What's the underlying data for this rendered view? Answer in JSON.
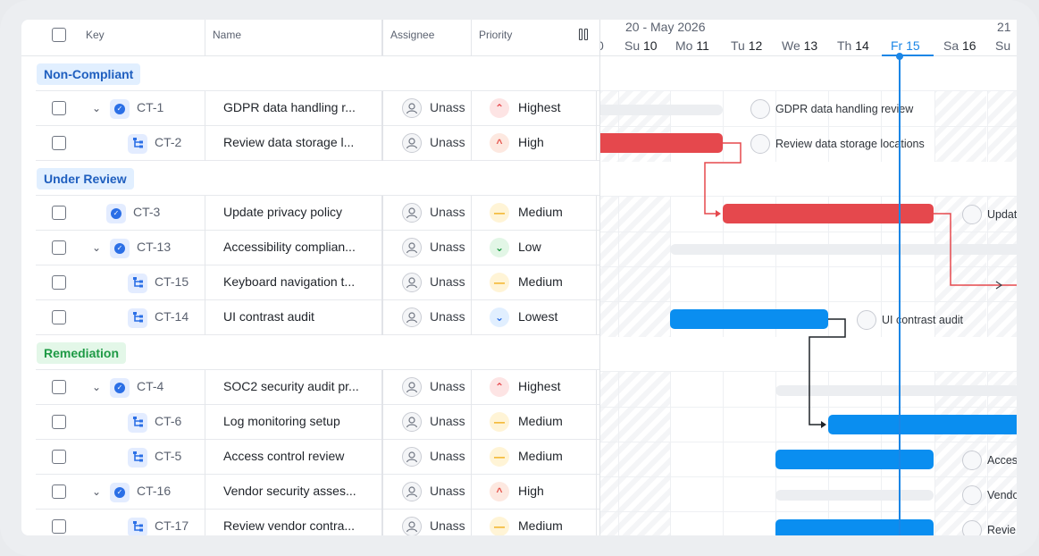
{
  "columns": {
    "key": "Key",
    "name": "Name",
    "assignee": "Assignee",
    "priority": "Priority"
  },
  "groups": [
    {
      "label": "Non-Compliant",
      "bg": "#e1efff",
      "fg": "#1f5fbf"
    },
    {
      "label": "Under Review",
      "bg": "#e1efff",
      "fg": "#1f5fbf"
    },
    {
      "label": "Remediation",
      "bg": "#e3f7e8",
      "fg": "#1e9a45"
    }
  ],
  "rows": [
    {
      "key": "CT-1",
      "name": "GDPR data handling r...",
      "assignee": "Unass",
      "priority": "Highest",
      "kind": "parent",
      "expand": true
    },
    {
      "key": "CT-2",
      "name": "Review data storage l...",
      "assignee": "Unass",
      "priority": "High",
      "kind": "sub"
    },
    {
      "key": "CT-3",
      "name": "Update privacy policy",
      "assignee": "Unass",
      "priority": "Medium",
      "kind": "parent",
      "expand": false
    },
    {
      "key": "CT-13",
      "name": "Accessibility complian...",
      "assignee": "Unass",
      "priority": "Low",
      "kind": "parent",
      "expand": true
    },
    {
      "key": "CT-15",
      "name": "Keyboard navigation t...",
      "assignee": "Unass",
      "priority": "Medium",
      "kind": "sub"
    },
    {
      "key": "CT-14",
      "name": "UI contrast audit",
      "assignee": "Unass",
      "priority": "Lowest",
      "kind": "sub"
    },
    {
      "key": "CT-4",
      "name": "SOC2 security audit pr...",
      "assignee": "Unass",
      "priority": "Highest",
      "kind": "parent",
      "expand": true
    },
    {
      "key": "CT-6",
      "name": "Log monitoring setup",
      "assignee": "Unass",
      "priority": "Medium",
      "kind": "sub"
    },
    {
      "key": "CT-5",
      "name": "Access control review",
      "assignee": "Unass",
      "priority": "Medium",
      "kind": "sub"
    },
    {
      "key": "CT-16",
      "name": "Vendor security asses...",
      "assignee": "Unass",
      "priority": "High",
      "kind": "parent",
      "expand": true
    },
    {
      "key": "CT-17",
      "name": "Review vendor contra...",
      "assignee": "Unass",
      "priority": "Medium",
      "kind": "sub"
    }
  ],
  "priority_styles": {
    "Highest": {
      "glyph": "⌃",
      "bg": "#fde4e4",
      "fg": "#e5484d"
    },
    "High": {
      "glyph": "^",
      "bg": "#fde8e0",
      "fg": "#e5534b"
    },
    "Medium": {
      "glyph": "—",
      "bg": "#fff4d6",
      "fg": "#f0a500"
    },
    "Low": {
      "glyph": "⌄",
      "bg": "#e2f6e6",
      "fg": "#1e9a45"
    },
    "Lowest": {
      "glyph": "⌄",
      "bg": "#e1efff",
      "fg": "#2b6fe6"
    }
  },
  "timeline": {
    "week_label": "20 - May 2026",
    "next_week_label": "21",
    "days": [
      {
        "dow": "Su",
        "num": "10"
      },
      {
        "dow": "Mo",
        "num": "11"
      },
      {
        "dow": "Tu",
        "num": "12"
      },
      {
        "dow": "We",
        "num": "13"
      },
      {
        "dow": "Th",
        "num": "14"
      },
      {
        "dow": "Fr",
        "num": "15",
        "today": true
      },
      {
        "dow": "Sa",
        "num": "16"
      },
      {
        "dow": "Su",
        "num": ""
      }
    ]
  },
  "gantt_labels": {
    "ct1": "GDPR data handling review",
    "ct2": "Review data storage locations",
    "ct3": "Updat",
    "ct14": "UI contrast audit",
    "ct5": "Acces",
    "ct16": "Vendo",
    "ct17": "Revie"
  },
  "colors": {
    "accent": "#1b86e6",
    "bar_red": "#e5484d",
    "bar_blue": "#0a8ef0"
  }
}
